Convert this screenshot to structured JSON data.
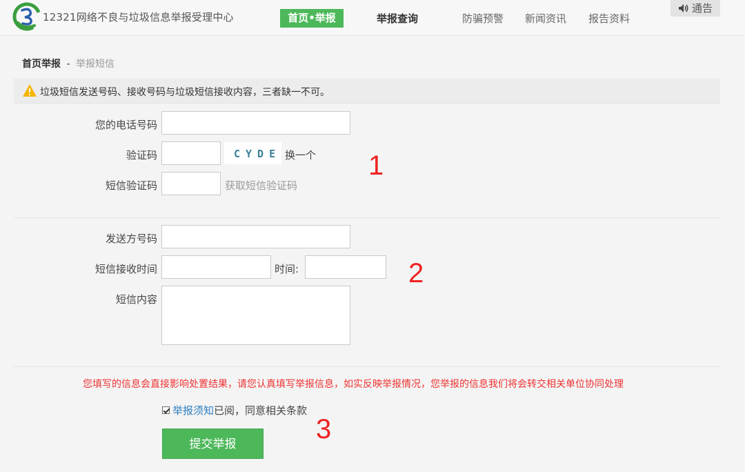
{
  "header": {
    "site_title": "12321网络不良与垃圾信息举报受理中心",
    "nav": {
      "home_report": "首页•举报",
      "report_query": "举报查询",
      "fraud_warning": "防骗预警",
      "news": "新闻资讯",
      "reports": "报告资料"
    },
    "notice": "通告"
  },
  "breadcrumb": {
    "current": "首页举报",
    "separator": "-",
    "sub": "举报短信"
  },
  "warning": "垃圾短信发送号码、接收号码与垃圾短信接收内容，三者缺一不可。",
  "form1": {
    "phone_label": "您的电话号码",
    "phone_value": "",
    "captcha_label": "验证码",
    "captcha_value": "",
    "captcha_text": "CYDE",
    "refresh_captcha": "换一个",
    "sms_code_label": "短信验证码",
    "sms_code_value": "",
    "get_sms_code": "获取短信验证码"
  },
  "form2": {
    "sender_label": "发送方号码",
    "sender_value": "",
    "receive_time_label": "短信接收时间",
    "receive_date_value": "",
    "time_label": "时间:",
    "time_value": "",
    "content_label": "短信内容",
    "content_value": ""
  },
  "notice_text": "您填写的信息会直接影响处置结果，请您认真填写举报信息，如实反映举报情况，您举报的信息我们将会转交相关单位协同处理",
  "agreement": {
    "checked": true,
    "link": "举报须知",
    "text": "已阅，同意相关条款"
  },
  "submit_label": "提交举报",
  "annotations": [
    "1",
    "2",
    "3"
  ],
  "colors": {
    "brand_green": "#4db85a",
    "warning_red": "#e33333",
    "annotation_red": "#ee2222",
    "link_blue": "#2f7fc1"
  }
}
